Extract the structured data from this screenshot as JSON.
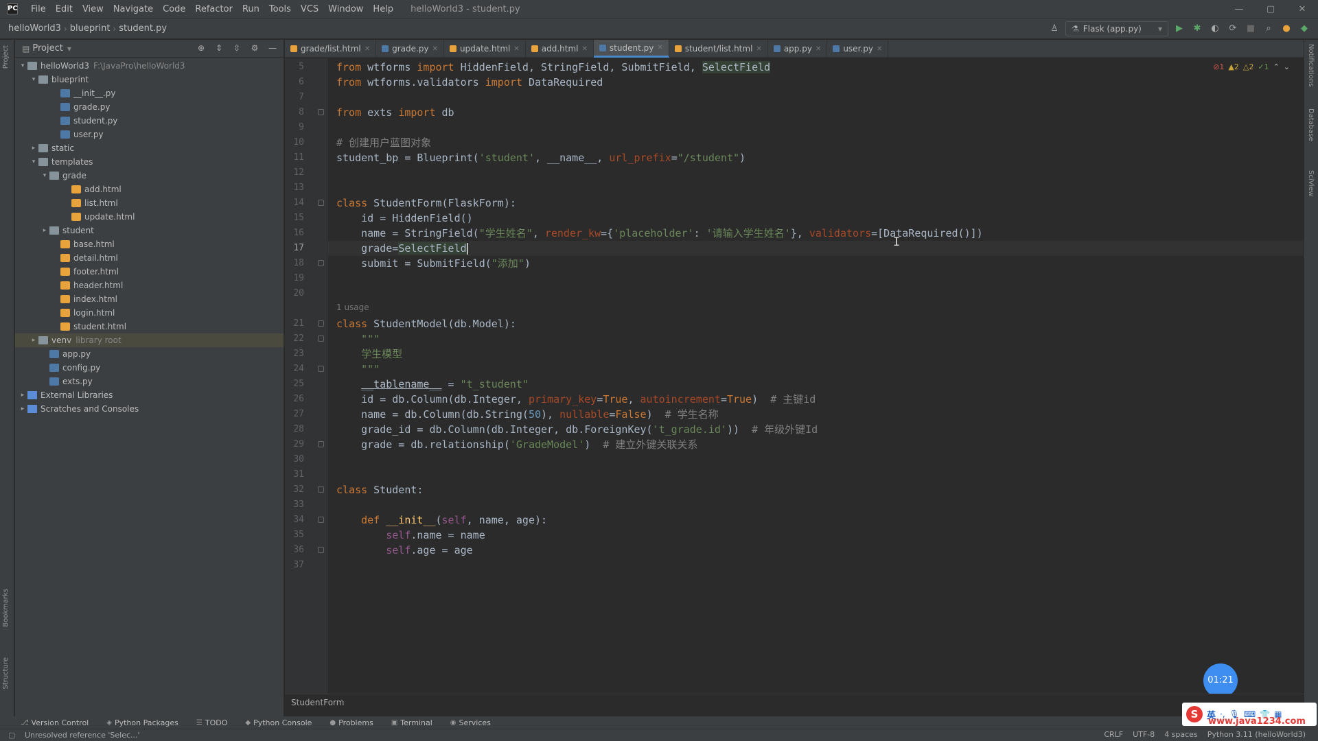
{
  "menubar": {
    "items": [
      "File",
      "Edit",
      "View",
      "Navigate",
      "Code",
      "Refactor",
      "Run",
      "Tools",
      "VCS",
      "Window",
      "Help"
    ],
    "window_title": "helloWorld3 - student.py"
  },
  "navbar": {
    "breadcrumbs": [
      "helloWorld3",
      "blueprint",
      "student.py"
    ],
    "run_config": "Flask (app.py)"
  },
  "project_panel": {
    "title": "Project",
    "root": "helloWorld3",
    "root_path": "F:\\JavaPro\\helloWorld3",
    "venv_hint": "library root",
    "tree": [
      {
        "label": "helloWorld3",
        "indent": 0,
        "arrow": "▾",
        "icon": "folder"
      },
      {
        "label": "blueprint",
        "indent": 1,
        "arrow": "▾",
        "icon": "folder"
      },
      {
        "label": "__init__.py",
        "indent": 3,
        "arrow": "",
        "icon": "py"
      },
      {
        "label": "grade.py",
        "indent": 3,
        "arrow": "",
        "icon": "py"
      },
      {
        "label": "student.py",
        "indent": 3,
        "arrow": "",
        "icon": "py"
      },
      {
        "label": "user.py",
        "indent": 3,
        "arrow": "",
        "icon": "py"
      },
      {
        "label": "static",
        "indent": 1,
        "arrow": "▸",
        "icon": "folder"
      },
      {
        "label": "templates",
        "indent": 1,
        "arrow": "▾",
        "icon": "folder"
      },
      {
        "label": "grade",
        "indent": 2,
        "arrow": "▾",
        "icon": "folder"
      },
      {
        "label": "add.html",
        "indent": 4,
        "arrow": "",
        "icon": "html"
      },
      {
        "label": "list.html",
        "indent": 4,
        "arrow": "",
        "icon": "html"
      },
      {
        "label": "update.html",
        "indent": 4,
        "arrow": "",
        "icon": "html"
      },
      {
        "label": "student",
        "indent": 2,
        "arrow": "▸",
        "icon": "folder"
      },
      {
        "label": "base.html",
        "indent": 3,
        "arrow": "",
        "icon": "html"
      },
      {
        "label": "detail.html",
        "indent": 3,
        "arrow": "",
        "icon": "html"
      },
      {
        "label": "footer.html",
        "indent": 3,
        "arrow": "",
        "icon": "html"
      },
      {
        "label": "header.html",
        "indent": 3,
        "arrow": "",
        "icon": "html"
      },
      {
        "label": "index.html",
        "indent": 3,
        "arrow": "",
        "icon": "html"
      },
      {
        "label": "login.html",
        "indent": 3,
        "arrow": "",
        "icon": "html"
      },
      {
        "label": "student.html",
        "indent": 3,
        "arrow": "",
        "icon": "html"
      },
      {
        "label": "venv",
        "indent": 1,
        "arrow": "▸",
        "icon": "folder",
        "selected": true
      },
      {
        "label": "app.py",
        "indent": 2,
        "arrow": "",
        "icon": "py"
      },
      {
        "label": "config.py",
        "indent": 2,
        "arrow": "",
        "icon": "py"
      },
      {
        "label": "exts.py",
        "indent": 2,
        "arrow": "",
        "icon": "py"
      },
      {
        "label": "External Libraries",
        "indent": 0,
        "arrow": "▸",
        "icon": "lib"
      },
      {
        "label": "Scratches and Consoles",
        "indent": 0,
        "arrow": "▸",
        "icon": "lib"
      }
    ]
  },
  "tabs": [
    {
      "label": "grade/list.html",
      "icon": "html",
      "active": false
    },
    {
      "label": "grade.py",
      "icon": "py",
      "active": false
    },
    {
      "label": "update.html",
      "icon": "html",
      "active": false
    },
    {
      "label": "add.html",
      "icon": "html",
      "active": false
    },
    {
      "label": "student.py",
      "icon": "py",
      "active": true
    },
    {
      "label": "student/list.html",
      "icon": "html",
      "active": false
    },
    {
      "label": "app.py",
      "icon": "py",
      "active": false
    },
    {
      "label": "user.py",
      "icon": "py",
      "active": false
    }
  ],
  "editor": {
    "current_line": 17,
    "usage_hint": "1 usage",
    "inspection": {
      "errors": "1",
      "warnings": "2",
      "weak": "2",
      "ok": "1"
    },
    "lines": [
      {
        "n": 5,
        "html": "<span class=\"kw\">from</span> wtforms <span class=\"kw\">import</span> HiddenField, StringField, SubmitField, <span class=\"hl\">SelectField</span>"
      },
      {
        "n": 6,
        "html": "<span class=\"kw\">from</span> wtforms.validators <span class=\"kw\">import</span> DataRequired"
      },
      {
        "n": 7,
        "html": ""
      },
      {
        "n": 8,
        "html": "<span class=\"kw\">from</span> exts <span class=\"kw\">import</span> db"
      },
      {
        "n": 9,
        "html": ""
      },
      {
        "n": 10,
        "html": "<span class=\"cmt\"># 创建用户蓝图对象</span>"
      },
      {
        "n": 11,
        "html": "student_bp = Blueprint(<span class=\"str\">'student'</span>, __name__, <span class=\"prm\">url_prefix</span>=<span class=\"str\">\"/student\"</span>)"
      },
      {
        "n": 12,
        "html": ""
      },
      {
        "n": 13,
        "html": ""
      },
      {
        "n": 14,
        "html": "<span class=\"kw\">class</span> StudentForm(FlaskForm):"
      },
      {
        "n": 15,
        "html": "    id = HiddenField()"
      },
      {
        "n": 16,
        "html": "    name = StringField(<span class=\"str\">\"学生姓名\"</span>, <span class=\"prm\">render_kw</span>={<span class=\"str\">'placeholder'</span>: <span class=\"str\">'请输入学生姓名'</span>}, <span class=\"prm\">validators</span>=[DataRequired()])"
      },
      {
        "n": 17,
        "html": "    grade=<span class=\"hl\">SelectField</span><span class=\"caret\"></span>"
      },
      {
        "n": 18,
        "html": "    submit = SubmitField(<span class=\"str\">\"添加\"</span>)"
      },
      {
        "n": 19,
        "html": ""
      },
      {
        "n": 20,
        "html": ""
      },
      {
        "n": 21,
        "html": "<span class=\"kw\">class</span> StudentModel(db.Model):"
      },
      {
        "n": 22,
        "html": "    <span class=\"str\">\"\"\"</span>"
      },
      {
        "n": 23,
        "html": "    <span class=\"str\">学生模型</span>"
      },
      {
        "n": 24,
        "html": "    <span class=\"str\">\"\"\"</span>"
      },
      {
        "n": 25,
        "html": "    <span class=\"dunder\">__tablename__</span> = <span class=\"str\">\"t_student\"</span>"
      },
      {
        "n": 26,
        "html": "    id = db.Column(db.Integer, <span class=\"prm\">primary_key</span>=<span class=\"kw\">True</span>, <span class=\"prm\">autoincrement</span>=<span class=\"kw\">True</span>)  <span class=\"cmt\"># 主键id</span>"
      },
      {
        "n": 27,
        "html": "    name = db.Column(db.String(<span style=\"color:#6897bb\">50</span>), <span class=\"prm\">nullable</span>=<span class=\"kw\">False</span>)  <span class=\"cmt\"># 学生名称</span>"
      },
      {
        "n": 28,
        "html": "    grade_id = db.Column(db.Integer, db.ForeignKey(<span class=\"str\">'t_grade.id'</span>))  <span class=\"cmt\"># 年级外键Id</span>"
      },
      {
        "n": 29,
        "html": "    grade = db.relationship(<span class=\"str\">'GradeModel'</span>)  <span class=\"cmt\"># 建立外键关联关系</span>"
      },
      {
        "n": 30,
        "html": ""
      },
      {
        "n": 31,
        "html": ""
      },
      {
        "n": 32,
        "html": "<span class=\"kw\">class</span> Student:"
      },
      {
        "n": 33,
        "html": ""
      },
      {
        "n": 34,
        "html": "    <span class=\"kw\">def</span> <span class=\"fn\">__init__</span>(<span class=\"slf\">self</span>, name, age):"
      },
      {
        "n": 35,
        "html": "        <span class=\"slf\">self</span>.name = name"
      },
      {
        "n": 36,
        "html": "        <span class=\"slf\">self</span>.age = age"
      },
      {
        "n": 37,
        "html": ""
      }
    ],
    "folds": [
      8,
      14,
      18,
      21,
      22,
      24,
      29,
      32,
      34,
      36
    ]
  },
  "breadcrumb_bar": {
    "label": "StudentForm"
  },
  "timer": "01:21",
  "tool_windows": [
    {
      "label": "Version Control",
      "icon": "⎇"
    },
    {
      "label": "Python Packages",
      "icon": "◈"
    },
    {
      "label": "TODO",
      "icon": "☰"
    },
    {
      "label": "Python Console",
      "icon": "◆"
    },
    {
      "label": "Problems",
      "icon": "●"
    },
    {
      "label": "Terminal",
      "icon": "▣"
    },
    {
      "label": "Services",
      "icon": "◉"
    }
  ],
  "status_bar": {
    "message": "Unresolved reference 'Selec...'",
    "right": [
      "CRLF",
      "UTF-8",
      "4 spaces",
      "Python 3.11 (helloWorld3)"
    ]
  },
  "ime": {
    "label": "英",
    "watermark": "www.java1234.com"
  },
  "strips": {
    "left": [
      "Project",
      "Bookmarks",
      "Structure"
    ],
    "right": [
      "Notifications",
      "Database",
      "SciView"
    ]
  }
}
